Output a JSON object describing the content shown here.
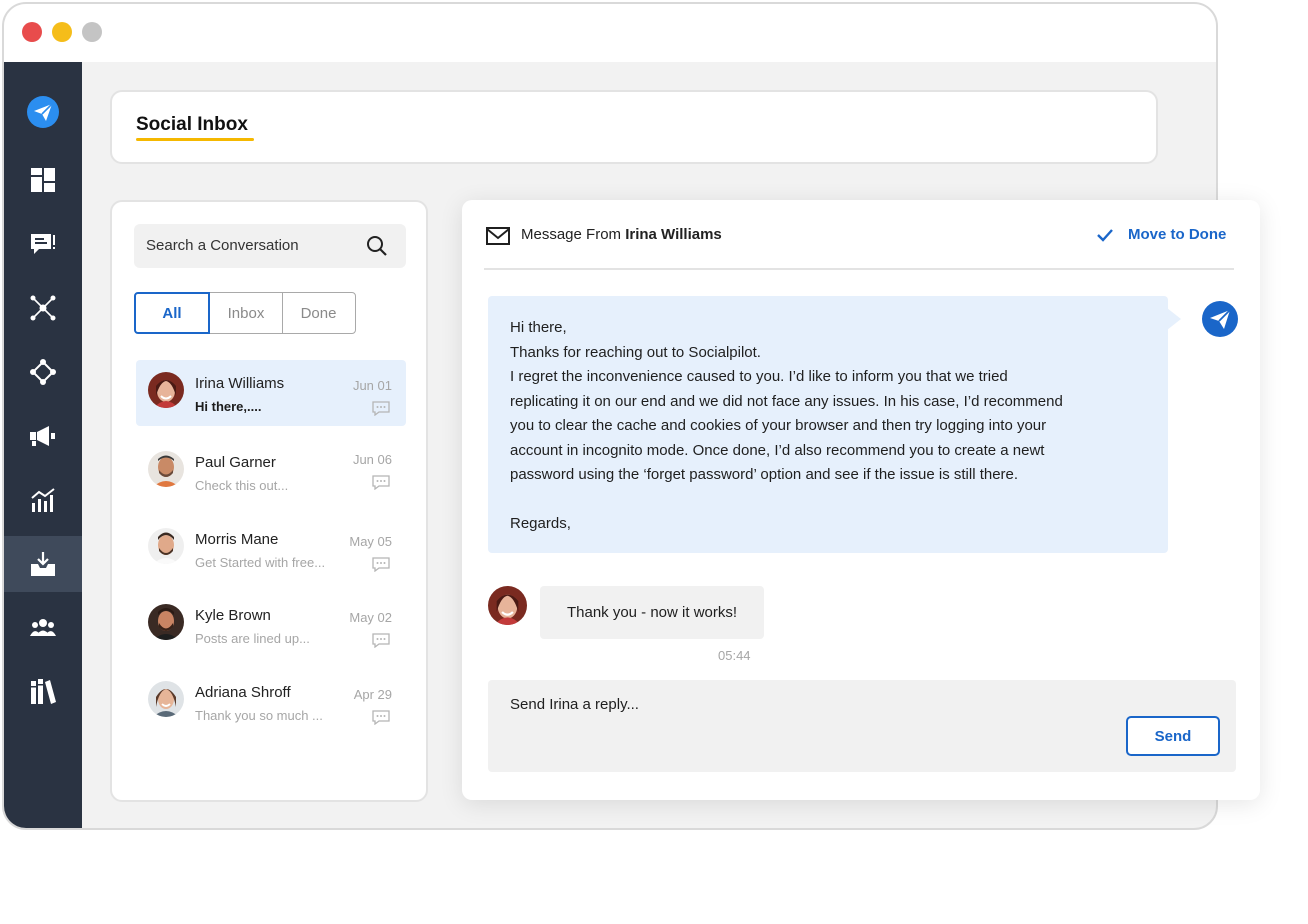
{
  "header": {
    "title": "Social Inbox"
  },
  "sidebar": {
    "items": [
      {
        "icon": "paper-plane-logo-icon"
      },
      {
        "icon": "dashboard-icon"
      },
      {
        "icon": "posts-icon"
      },
      {
        "icon": "network-icon"
      },
      {
        "icon": "connections-icon"
      },
      {
        "icon": "megaphone-icon"
      },
      {
        "icon": "analytics-icon"
      },
      {
        "icon": "inbox-icon",
        "active": true
      },
      {
        "icon": "team-icon"
      },
      {
        "icon": "library-icon"
      }
    ]
  },
  "search": {
    "placeholder": "Search a Conversation"
  },
  "filters": [
    "All",
    "Inbox",
    "Done"
  ],
  "conversations": [
    {
      "name": "Irina Williams",
      "preview": "Hi there,....",
      "date": "Jun 01",
      "active": true
    },
    {
      "name": "Paul Garner",
      "preview": "Check this out...",
      "date": "Jun 06"
    },
    {
      "name": "Morris Mane",
      "preview": "Get Started with free...",
      "date": "May 05"
    },
    {
      "name": "Kyle Brown",
      "preview": "Posts are lined up...",
      "date": "May 02"
    },
    {
      "name": "Adriana Shroff",
      "preview": "Thank you so much ...",
      "date": "Apr 29"
    }
  ],
  "message": {
    "from_prefix": "Message From",
    "from_name": "Irina Williams",
    "move_done": "Move to Done",
    "outgoing_lines": [
      "Hi there,",
      "Thanks for reaching out to Socialpilot.",
      "I regret the inconvenience caused to you. I’d like to inform you that we tried",
      "replicating it on our end and we did not face any issues. In his case, I’d recommend",
      "you to clear the cache and cookies of your browser and then try logging into your",
      "account in incognito mode. Once done, I’d also recommend you to create a newt",
      "password using the ‘forget password’ option and see if the issue is still there.",
      "",
      "Regards,"
    ],
    "incoming": "Thank you - now it works!",
    "time": "05:44"
  },
  "reply": {
    "placeholder": "Send Irina a reply...",
    "send_label": "Send"
  },
  "colors": {
    "accent": "#1a66c9",
    "sidebar": "#2a3342",
    "highlight": "#f5b800",
    "bubble": "#e6f0fc"
  }
}
